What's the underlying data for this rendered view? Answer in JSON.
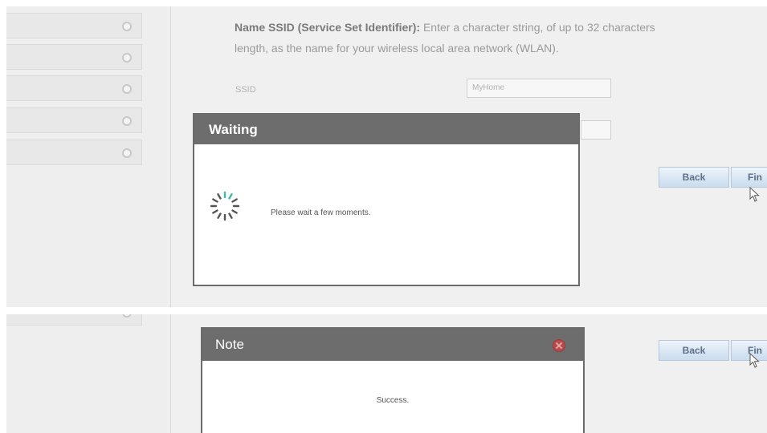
{
  "top_panel": {
    "sidebar": {
      "items": [
        {
          "icon": "radio-dot-icon"
        },
        {
          "icon": "radio-dot-icon"
        },
        {
          "icon": "radio-dot-icon"
        },
        {
          "icon": "radio-dot-icon"
        },
        {
          "icon": "radio-dot-icon"
        }
      ]
    },
    "description": {
      "bold_label": "Name SSID (Service Set Identifier):",
      "text_line1": " Enter a character string, of up to 32 characters",
      "text_line2": "length, as the name for your wireless local area network (WLAN)."
    },
    "ssid_field": {
      "label": "SSID",
      "value": "MyHome"
    },
    "buttons": {
      "back_label": "Back",
      "finish_label": "Fin"
    },
    "waiting_dialog": {
      "title": "Waiting",
      "message": "Please wait a few moments.",
      "icon": "loading-spinner-icon"
    }
  },
  "bottom_panel": {
    "buttons": {
      "back_label": "Back",
      "finish_label": "Fin"
    },
    "note_dialog": {
      "title": "Note",
      "message": "Success.",
      "close_icon": "close-icon"
    }
  },
  "colors": {
    "dialog_header": "#6d6d6d",
    "button_gradient_top": "#eef4fa",
    "button_gradient_bottom": "#c9dcee",
    "spinner_accent": "#3fb8b0",
    "close_button": "#b84a4a"
  }
}
